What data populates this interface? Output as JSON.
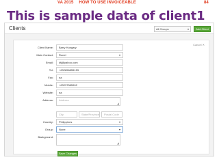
{
  "slide": {
    "course_label": "VA 2015",
    "course_subtitle": "HOW TO USE INVOICEABLE",
    "page_number": "84",
    "title": "This is sample data of client1"
  },
  "app": {
    "header_title": "Clients",
    "group_select_value": "All Groups",
    "add_client_label": "Add Client",
    "cancel_label": "Cancel",
    "save_label": "Save Changes"
  },
  "form": {
    "client_name": {
      "label": "Client Name:",
      "value": "Barry Hungary"
    },
    "main_contact": {
      "label": "Main Contact:",
      "value": "Ronel"
    },
    "email": {
      "label": "Email:",
      "value": "kfj@yahoo.com"
    },
    "tel": {
      "label": "Tel:",
      "value": "+632856855153"
    },
    "fax": {
      "label": "Fax:",
      "value": "na"
    },
    "mobile": {
      "label": "Mobile:",
      "value": "+63237585902"
    },
    "website": {
      "label": "Website:",
      "value": "na"
    },
    "address": {
      "label": "Address:",
      "placeholder": "Address"
    },
    "city": {
      "placeholder": "City"
    },
    "state": {
      "placeholder": "State/Province"
    },
    "postal": {
      "placeholder": "Postal Code"
    },
    "country": {
      "label": "Country:",
      "value": "Philippines"
    },
    "group": {
      "label": "Group:",
      "value": "None"
    },
    "background": {
      "label": "Background:"
    }
  },
  "colors": {
    "slide_title": "#6a2a83",
    "slide_header": "#e03a1e",
    "button_green": "#5aa83a"
  }
}
